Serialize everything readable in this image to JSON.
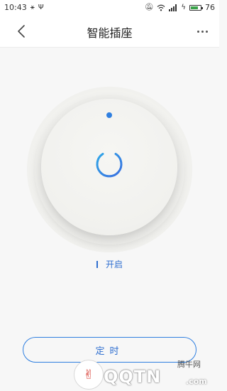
{
  "status_bar": {
    "time": "10:43",
    "icons_left": [
      "usb-icon",
      "debug-icon"
    ],
    "icons_right": [
      "mute-icon",
      "wifi-icon",
      "signal-icon",
      "charging-icon",
      "battery-icon"
    ],
    "battery_level": "76",
    "battery_fill_fraction": 0.76
  },
  "header": {
    "title": "智能插座",
    "back_icon": "chevron-left-icon",
    "more_icon": "more-dots-icon"
  },
  "power": {
    "icon": "power-icon",
    "accent_color": "#2f7fe0",
    "state_label": "开启"
  },
  "actions": {
    "timer_label": "定时"
  },
  "watermark": {
    "brand": "QQTN",
    "suffix": ".com",
    "cn": "腾牛网"
  }
}
